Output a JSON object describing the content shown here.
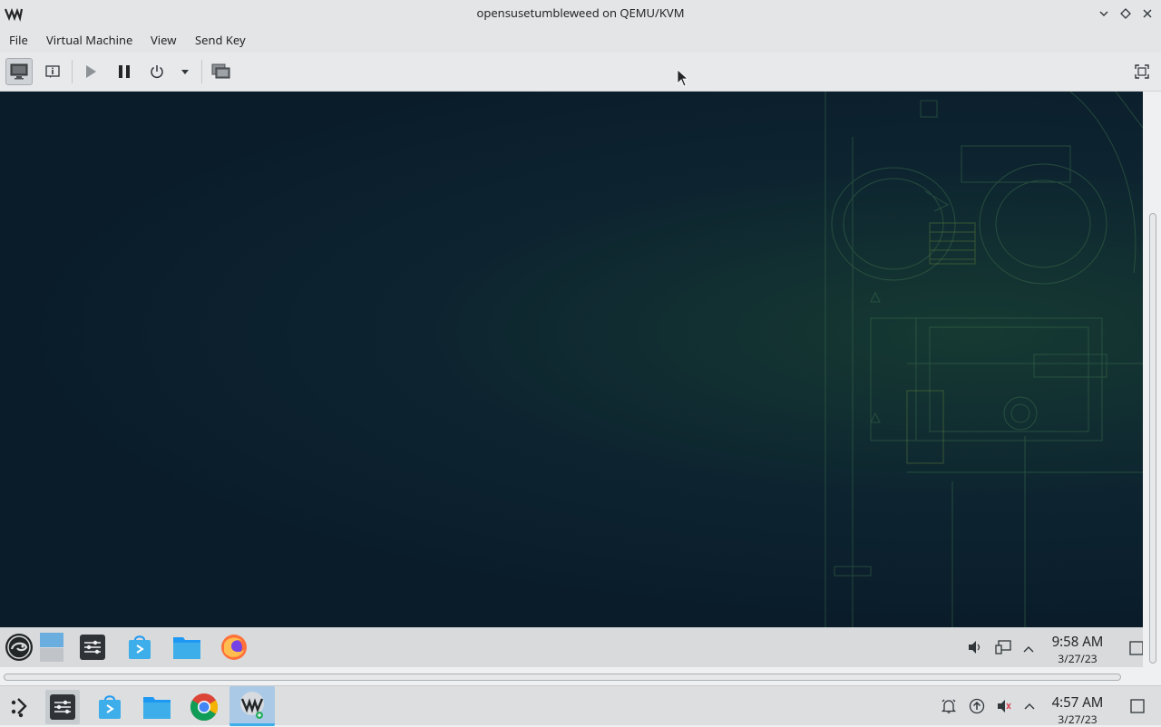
{
  "window": {
    "title": "opensusetumbleweed on QEMU/KVM",
    "app_icon": "virt-manager-icon",
    "buttons": [
      "minimize",
      "maximize",
      "close"
    ]
  },
  "menu": {
    "items": [
      "File",
      "Virtual Machine",
      "View",
      "Send Key"
    ]
  },
  "toolbar": {
    "items": [
      {
        "icon": "console-monitor-icon",
        "active": true
      },
      {
        "icon": "details-info-icon"
      },
      {
        "icon": "play-icon"
      },
      {
        "icon": "pause-icon"
      },
      {
        "icon": "power-icon"
      },
      {
        "icon": "dropdown-arrow-icon"
      },
      {
        "icon": "snapshot-icon"
      },
      {
        "icon": "fullscreen-icon"
      }
    ]
  },
  "guest_panel": {
    "time": "9:58 AM",
    "date": "3/27/23",
    "apps": [
      "opensuse-menu-icon",
      "desktop-pager-icon",
      "settings-icon",
      "discover-store-icon",
      "file-manager-icon",
      "firefox-icon"
    ],
    "tray": [
      "volume-icon",
      "network-icon",
      "expand-tray-icon",
      "show-desktop-icon"
    ]
  },
  "host_panel": {
    "time": "4:57 AM",
    "date": "3/27/23",
    "apps": [
      "app-launcher-icon",
      "settings-icon",
      "discover-store-icon",
      "file-manager-icon",
      "chrome-icon",
      "virt-manager-icon"
    ],
    "tray": [
      "notifications-icon",
      "updates-icon",
      "muted-volume-icon",
      "expand-tray-icon",
      "show-desktop-icon"
    ]
  },
  "colors": {
    "accent": "#3daee9",
    "vm_background": "#0b1d2b",
    "wallpaper_lines": "#3b6b4a"
  }
}
